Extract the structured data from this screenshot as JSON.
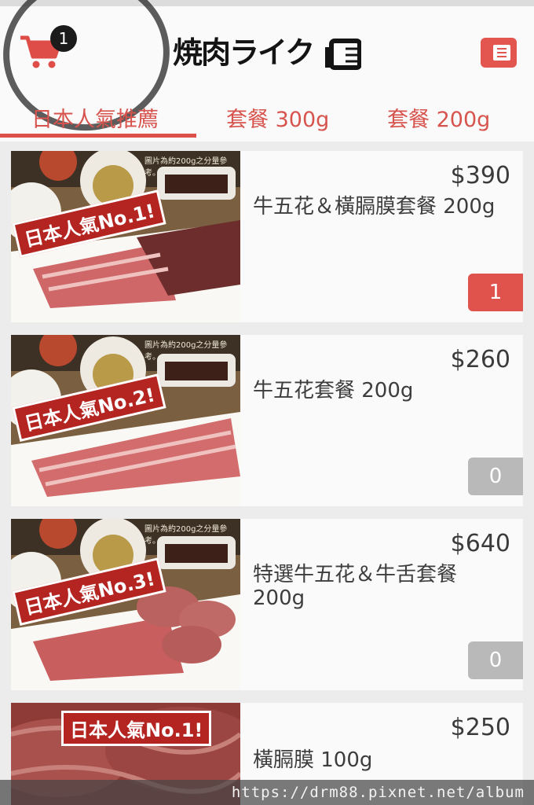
{
  "header": {
    "cart_count": "1",
    "logo_text": "焼肉ライク"
  },
  "tabs": [
    {
      "label": "日本人氣推薦",
      "active": true
    },
    {
      "label": "套餐 300g",
      "active": false
    },
    {
      "label": "套餐 200g",
      "active": false
    }
  ],
  "products": [
    {
      "price": "$390",
      "name": "牛五花＆橫膈膜套餐 200g",
      "qty": "1",
      "banner": "日本人氣No.1!",
      "note": "圖片為約200g之分量參考。"
    },
    {
      "price": "$260",
      "name": "牛五花套餐 200g",
      "qty": "0",
      "banner": "日本人氣No.2!",
      "note": "圖片為約200g之分量參考。"
    },
    {
      "price": "$640",
      "name": "特選牛五花＆牛舌套餐 200g",
      "qty": "0",
      "banner": "日本人氣No.3!",
      "note": "圖片為約200g之分量參考。"
    },
    {
      "price": "$250",
      "name": "橫膈膜 100g",
      "banner": "日本人氣No.1!"
    }
  ],
  "watermark": "https://drm88.pixnet.net/album",
  "colors": {
    "accent": "#e0534c",
    "tab_text": "#d7544e",
    "qty_off": "#b9b9b9",
    "card_bg": "#fafafa",
    "page_bg": "#ececec"
  }
}
